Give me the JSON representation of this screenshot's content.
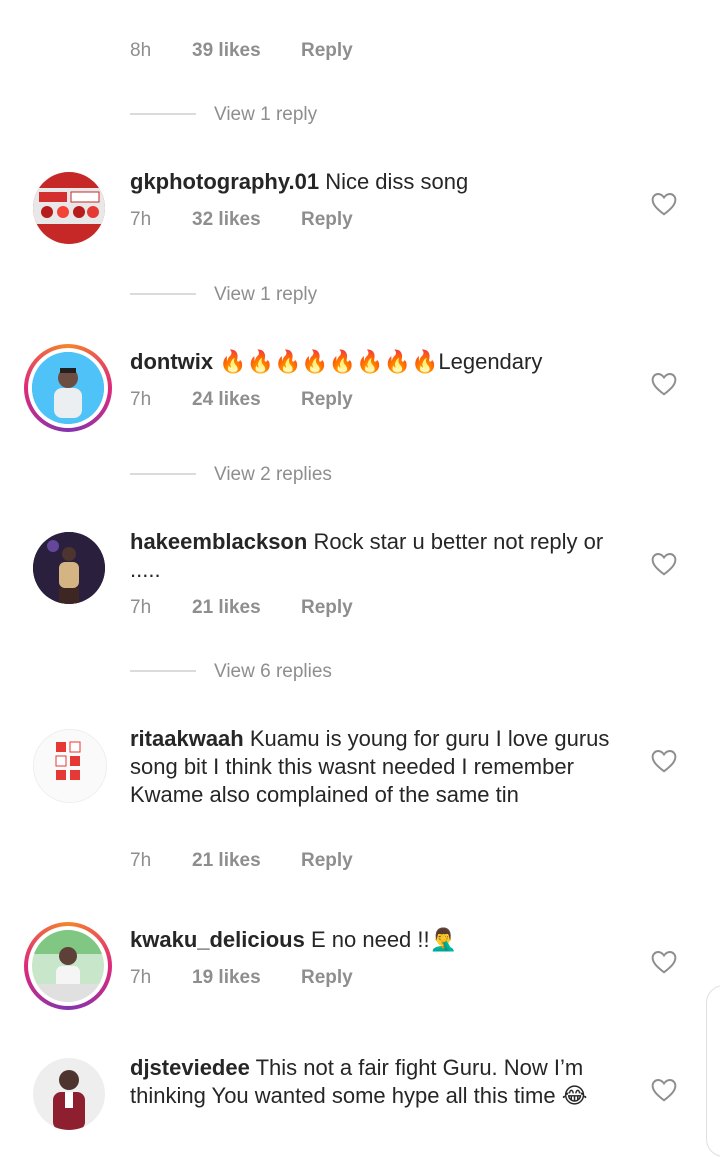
{
  "colors": {
    "primary_text": "#262626",
    "secondary_text": "#8e8e8e",
    "divider": "#dbdbdb"
  },
  "top": {
    "time": "8h",
    "likes": "39 likes",
    "reply": "Reply",
    "view_replies": "View 1 reply"
  },
  "comments": [
    {
      "username": "gkphotography.01",
      "text": "Nice diss song",
      "time": "7h",
      "likes": "32 likes",
      "reply": "Reply",
      "view_replies": "View 1 reply"
    },
    {
      "username": "dontwix",
      "text": "🔥🔥🔥🔥🔥🔥🔥🔥Legendary",
      "time": "7h",
      "likes": "24 likes",
      "reply": "Reply",
      "view_replies": "View 2 replies"
    },
    {
      "username": "hakeemblackson",
      "text": "Rock star u better not reply or .....",
      "time": "7h",
      "likes": "21 likes",
      "reply": "Reply",
      "view_replies": "View 6 replies"
    },
    {
      "username": "ritaakwaah",
      "text": "Kuamu is young for guru I love gurus song bit I think this wasnt needed I remember  Kwame  also complained of the same tin",
      "time": "7h",
      "likes": "21 likes",
      "reply": "Reply"
    },
    {
      "username": "kwaku_delicious",
      "text": "E no need !!🤦‍♂️",
      "time": "7h",
      "likes": "19 likes",
      "reply": "Reply"
    },
    {
      "username": "djsteviedee",
      "text": "This not a fair fight Guru. Now I’m thinking You wanted some hype all this time 😂"
    }
  ]
}
